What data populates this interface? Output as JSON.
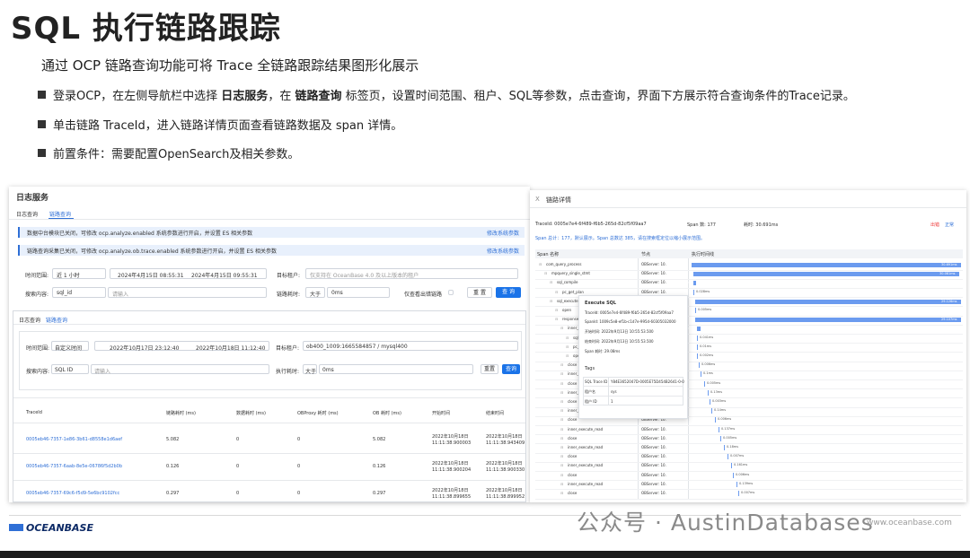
{
  "slide": {
    "title": "SQL 执行链路跟踪",
    "subtitle": "通过 OCP 链路查询功能可将 Trace 全链路跟踪结果图形化展示",
    "b1_pre": "登录OCP，在左侧导航栏中选择 ",
    "b1_em1": "日志服务",
    "b1_mid": "，在 ",
    "b1_em2": "链路查询",
    "b1_post": " 标签页，设置时间范围、租户、SQL等参数，点击查询，界面下方展示符合查询条件的Trace记录。",
    "b2": "单击链路 TraceId，进入链路详情页面查看链路数据及 span 详情。",
    "b3": "前置条件：需要配置OpenSearch及相关参数。"
  },
  "left": {
    "title": "日志服务",
    "tab1": "日志查询",
    "tab2": "链路查询",
    "banner1": "数据中台模块已关闭，可修改 ocp.analyze.enabled 系统参数进行开启，并设置 ES 相关参数",
    "banner2": "链路查询采集已关闭，可修改 ocp.analyze.ob.trace.enabled 系统参数进行开启，并设置 ES 相关参数",
    "banner_link": "修改系统参数",
    "f_time": "时间范围:",
    "f_time_val": "近 1 小时",
    "f_from": "2024年4月15日 08:55:31",
    "f_to": "2024年4月15日 09:55:31",
    "f_tenant": "目标租户:",
    "f_tenant_ph": "仅支持在 OceanBase 4.0 及以上版本的租户",
    "f_search": "搜索内容:",
    "f_search_type": "sql_id",
    "f_search_ph": "请输入",
    "f_exec": "链路耗时:",
    "f_gt": "大于",
    "f_ms": "0ms",
    "f_err": "仅查看出错链路",
    "reset": "重 置",
    "query": "查 询",
    "s_tab1": "日志查询",
    "s_tab2": "链路查询",
    "s_time": "时间范围:",
    "s_time_val": "自定义时间",
    "s_from": "2022年10月17日 23:12:40",
    "s_to": "2022年10月18日 11:12:40",
    "s_tenant": "目标租户:",
    "s_tenant_val": "ob400_1009:1665584857 / mysql400",
    "s_search": "搜索内容:",
    "s_type": "SQL ID",
    "s_ph": "请输入",
    "s_exec": "执行耗时:",
    "s_gt": "大于",
    "s_ms": "0ms",
    "s_reset": "重置",
    "s_query": "查询",
    "cols": [
      "TraceId",
      "链路耗时 (ms)",
      "数据耗时 (ms)",
      "OBProxy 耗时 (ms)",
      "OB 耗时 (ms)",
      "开始时间",
      "结束时间"
    ],
    "rows": [
      {
        "id": "0005eb46-7357-1e86-3b61-d8558e1d6aef",
        "a": "5.082",
        "b": "0",
        "c": "0",
        "d": "5.082",
        "s1": "2022年10月18日",
        "s2": "11:11:38.900003",
        "e1": "2022年10月18日",
        "e2": "11:11:38.943409"
      },
      {
        "id": "0005eb46-7357-6aab-8e5e-06786f5d2b0b",
        "a": "0.126",
        "b": "0",
        "c": "0",
        "d": "0.126",
        "s1": "2022年10月18日",
        "s2": "11:11:38.900204",
        "e1": "2022年10月18日",
        "e2": "11:11:38.900330"
      },
      {
        "id": "0005eb46-7357-69c6-f5d9-5e6bc9102fcc",
        "a": "0.297",
        "b": "0",
        "c": "0",
        "d": "0.297",
        "s1": "2022年10月18日",
        "s2": "11:11:38.899655",
        "e1": "2022年10月18日",
        "e2": "11:11:38.899952"
      }
    ]
  },
  "right": {
    "close": "X",
    "title": "链路详情",
    "trace": "TraceId: 0005e7e4-6f489-f6b5-265d-82cf5f09aa7",
    "spans": "Span 数: 177",
    "dur": "耗时: 30.691ms",
    "legend1": "出错",
    "legend2": "正常",
    "note": "Span 总计：177，默认展示。Span 总数达 385，请在搜索框定位以缩小展示范围。",
    "h1": "Span 名称",
    "h2": "节点",
    "h3": "执行时间线",
    "spans_list": [
      {
        "n": "com_query_process",
        "lv": 0
      },
      {
        "n": "mpquery_single_stmt",
        "lv": 1
      },
      {
        "n": "sql_compile",
        "lv": 2
      },
      {
        "n": "pc_get_plan",
        "lv": 3
      },
      {
        "n": "sql_execute",
        "lv": 2
      },
      {
        "n": "open",
        "lv": 3
      },
      {
        "n": "response_result",
        "lv": 3
      },
      {
        "n": "inner_execute_read",
        "lv": 4
      },
      {
        "n": "sql_compile",
        "lv": 5
      },
      {
        "n": "pc_get_plan",
        "lv": 5
      },
      {
        "n": "open",
        "lv": 5
      },
      {
        "n": "close",
        "lv": 4
      },
      {
        "n": "inner_execute_read",
        "lv": 4
      },
      {
        "n": "close",
        "lv": 4
      },
      {
        "n": "inner_execute_read",
        "lv": 4
      },
      {
        "n": "close",
        "lv": 4
      },
      {
        "n": "inner_execute_read",
        "lv": 4
      },
      {
        "n": "close",
        "lv": 4
      },
      {
        "n": "inner_execute_read",
        "lv": 4
      },
      {
        "n": "close",
        "lv": 4
      },
      {
        "n": "inner_execute_read",
        "lv": 4
      },
      {
        "n": "close",
        "lv": 4
      },
      {
        "n": "inner_execute_read",
        "lv": 4
      },
      {
        "n": "close",
        "lv": 4
      },
      {
        "n": "inner_execute_read",
        "lv": 4
      },
      {
        "n": "close",
        "lv": 4
      }
    ],
    "node": "OBServer: 10.",
    "timelines": [
      "30.691ms",
      "30.081ms",
      "0.172ms",
      "0.028ms",
      "29.126ms",
      "0.005ms",
      "29.107ms",
      "0.3ms",
      "0.041ms",
      "0.01ms",
      "0.002ms",
      "0.006ms",
      "0.1ms",
      "0.005ms",
      "0.13ms",
      "0.003ms",
      "0.14ms",
      "0.006ms",
      "0.137ms",
      "0.005ms",
      "0.18ms",
      "0.007ms",
      "0.161ms",
      "0.006ms",
      "0.139ms",
      "0.007ms"
    ],
    "popup": {
      "title": "Execute SQL",
      "trace": "TraceId:  0005e7e4-6f489-f6b5-265d-82cf5f09aa7",
      "span": "SpanId:  1009c5e8-ef1b-c1d7e-995d-60305032000",
      "start": "开始时间:  2022年9月13日 10:55:53.500",
      "end": "结束时间:  2022年9月13日 10:55:53.500",
      "dur": "Span 耗时:  29.08ms",
      "tags": "Tags",
      "k1": "SQL Trace ID",
      "v1": "Y84E3652047D-0005E75D454B2641-0-0",
      "k2": "租户名",
      "v2": "sys",
      "k3": "租户 ID",
      "v3": "1"
    }
  },
  "footer": {
    "logo": "OCEANBASE",
    "watermark": "公众号 · AustinDatabases",
    "url": "www.oceanbase.com"
  }
}
